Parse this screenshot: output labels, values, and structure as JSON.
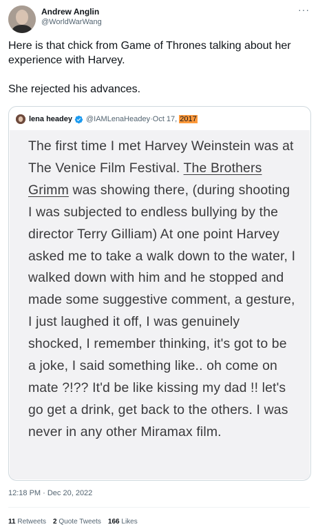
{
  "author": {
    "name": "Andrew Anglin",
    "handle": "@WorldWarWang"
  },
  "more_label": "···",
  "tweet": {
    "paragraph1": "Here is that chick from Game of Thrones talking about her experience with Harvey.",
    "paragraph2": "She rejected his advances."
  },
  "quoted": {
    "name": "lena headey",
    "handle": "@IAMLenaHeadey",
    "separator": " · ",
    "date": "Oct 17,",
    "year": "2017",
    "image_text": {
      "part1": "The first time I met Harvey Weinstein was at The Venice Film Festival. ",
      "underlined": "The Brothers Grimm",
      "part2": " was showing there, (during shooting I was subjected to endless bullying by the director Terry Gilliam) At one point Harvey asked me to take a walk down to the water, I walked down with him and he stopped and made some suggestive comment, a gesture, I just laughed it off, I was genuinely shocked, I remember thinking, it's got to be a joke, I said something like.. oh come on mate ?!?? It'd be like kissing my dad !! let's go get a drink, get back to the others. I was never in any other Miramax film."
    }
  },
  "timestamp": "12:18 PM · Dec 20, 2022",
  "stats": {
    "retweets_count": "11",
    "retweets_label": "Retweets",
    "quotes_count": "2",
    "quotes_label": "Quote Tweets",
    "likes_count": "166",
    "likes_label": "Likes"
  },
  "colors": {
    "verified": "#1d9bf0",
    "year_highlight": "#ff9a3c",
    "secondary_text": "#536471"
  }
}
